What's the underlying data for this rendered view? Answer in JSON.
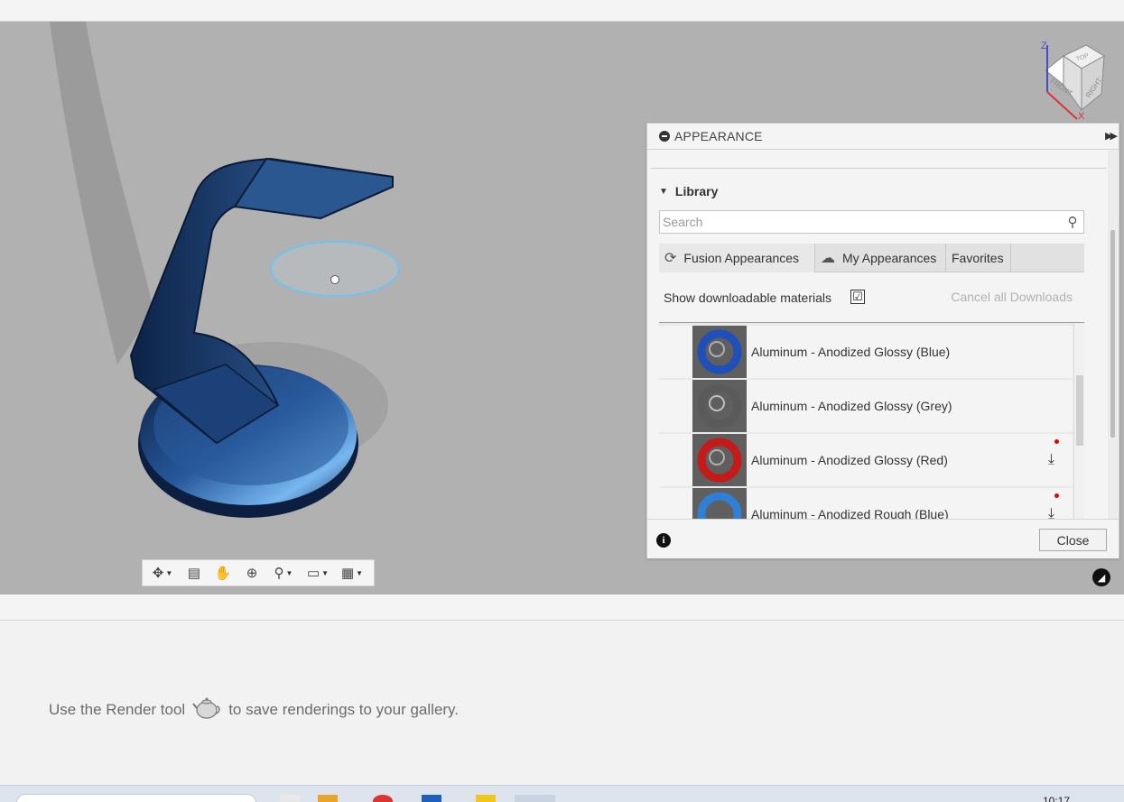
{
  "viewcube": {
    "axis_z": "Z",
    "axis_x": "X",
    "face_top": "TOP",
    "face_front": "FRONT",
    "face_right": "RIGHT"
  },
  "appearance_panel": {
    "title": "APPEARANCE",
    "library_label": "Library",
    "search_placeholder": "Search",
    "tabs": [
      {
        "label": "Fusion Appearances",
        "icon": "sync-icon"
      },
      {
        "label": "My Appearances",
        "icon": "cloud-icon"
      },
      {
        "label": "Favorites"
      }
    ],
    "show_downloadable_label": "Show downloadable materials",
    "show_downloadable_checked": "☑",
    "cancel_downloads_label": "Cancel all Downloads",
    "materials": [
      {
        "name": "Aluminum - Anodized Glossy (Blue)",
        "color": "#1f4fb8",
        "downloadable": false
      },
      {
        "name": "Aluminum - Anodized Glossy (Grey)",
        "color": "#5a5a5a",
        "downloadable": false
      },
      {
        "name": "Aluminum - Anodized Glossy (Red)",
        "color": "#c41a1a",
        "downloadable": true
      },
      {
        "name": "Aluminum - Anodized Rough (Blue)",
        "color": "#2f7fd4",
        "downloadable": true
      }
    ],
    "download_glyph": "⤓",
    "info_glyph": "i",
    "close_label": "Close"
  },
  "gallery_message": {
    "before": "Use the Render tool",
    "after": "to save renderings to your gallery."
  },
  "taskbar": {
    "clock": "10:17"
  }
}
